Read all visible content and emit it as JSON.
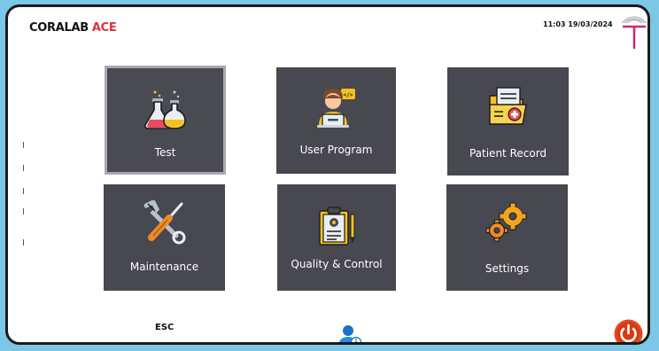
{
  "header": {
    "brand": "CORALAB",
    "brand_accent": "ACE",
    "datetime": "11:03 19/03/2024",
    "logo_icon": "lab-light-logo-icon"
  },
  "tiles": [
    {
      "label": "Test",
      "icon": "flask-icon"
    },
    {
      "label": "User Program",
      "icon": "programmer-icon"
    },
    {
      "label": "Patient Record",
      "icon": "medical-folder-icon"
    },
    {
      "label": "Maintenance",
      "icon": "tools-icon"
    },
    {
      "label": "Quality & Control",
      "icon": "clipboard-gear-icon"
    },
    {
      "label": "Settings",
      "icon": "gears-icon"
    }
  ],
  "footer": {
    "esc_label": "ESC",
    "user_icon": "user-info-icon",
    "power_icon": "power-icon"
  },
  "colors": {
    "background": "#7cc6e6",
    "tile": "#474850",
    "accent": "#e0303b",
    "power": "#e14a1c"
  }
}
